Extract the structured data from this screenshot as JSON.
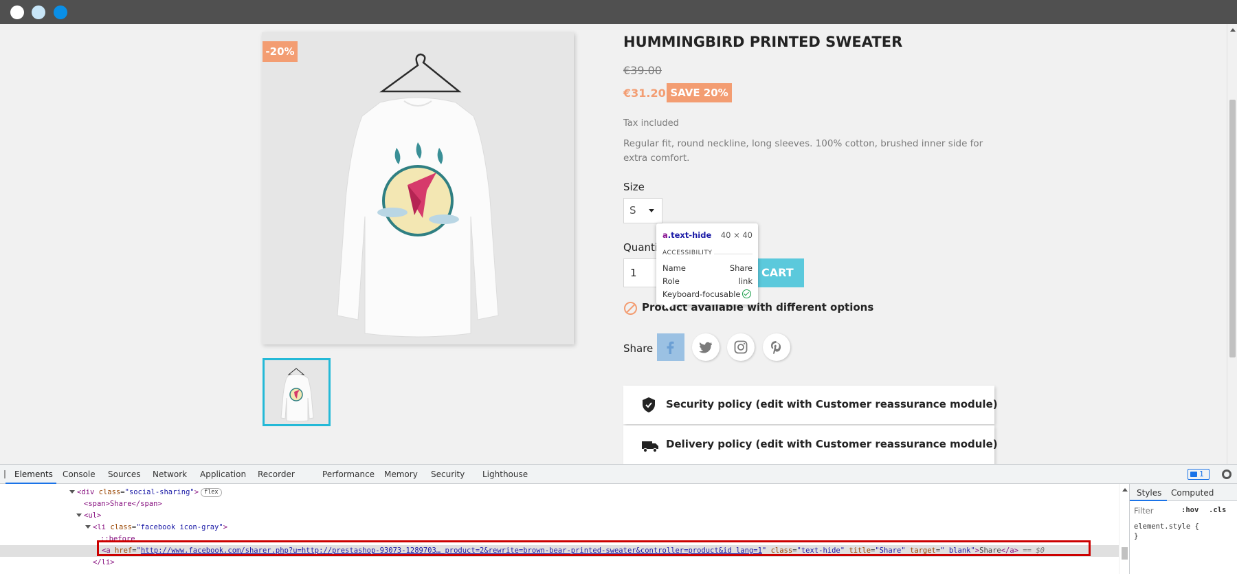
{
  "window": {
    "controls": [
      "close",
      "minimize",
      "maximize"
    ]
  },
  "product": {
    "discount_badge": "-20%",
    "title": "HUMMINGBIRD PRINTED SWEATER",
    "old_price": "€39.00",
    "new_price": "€31.20",
    "save_badge": "SAVE 20%",
    "tax_note": "Tax included",
    "description": "Regular fit, round neckline, long sleeves. 100% cotton, brushed inner side for extra comfort.",
    "size_label": "Size",
    "size_value": "S",
    "quantity_label": "Quantity",
    "quantity_value": "1",
    "add_to_cart_label": "CART",
    "availability_text": "Product available with different options",
    "share_label": "Share",
    "social_icons": [
      "facebook-icon",
      "twitter-icon",
      "instagram-icon",
      "pinterest-icon"
    ],
    "reassurance": [
      "Security policy (edit with Customer reassurance module)",
      "Delivery policy (edit with Customer reassurance module)"
    ]
  },
  "tooltip": {
    "selector_tag": "a",
    "selector_class": ".text-hide",
    "dimensions": "40 × 40",
    "section": "ACCESSIBILITY",
    "rows": [
      {
        "label": "Name",
        "value": "Share"
      },
      {
        "label": "Role",
        "value": "link"
      },
      {
        "label": "Keyboard-focusable",
        "value": ""
      }
    ]
  },
  "devtools": {
    "tabs": [
      "Elements",
      "Console",
      "Sources",
      "Network",
      "Application",
      "Recorder",
      "Performance",
      "Memory",
      "Security",
      "Lighthouse"
    ],
    "issues_count": "1",
    "dom": {
      "line1_tag": "div",
      "line1_attr": "class",
      "line1_val": "social-sharing",
      "line1_badge": "flex",
      "line2": "<span>Share</span>",
      "line3": "<ul>",
      "line4_tag": "li",
      "line4_attr": "class",
      "line4_val": "facebook icon-gray",
      "line5": "::before",
      "line6_href": "http://www.facebook.com/sharer.php?u=http://prestashop-93073-1289703… product=2&rewrite=brown-bear-printed-sweater&controller=product&id_lang=1",
      "line6_class": "text-hide",
      "line6_title": "Share",
      "line6_target": "_blank",
      "line6_text": "Share",
      "line6_suffix": "== $0",
      "line7": "</li>"
    },
    "styles": {
      "tabs": [
        "Styles",
        "Computed"
      ],
      "filter_placeholder": "Filter",
      "hov": ":hov",
      "cls": ".cls",
      "rule_open": "element.style {",
      "rule_close": "}"
    }
  },
  "colors": {
    "accent": "#f39d72",
    "cart_button": "#5bc9dc",
    "thumb_border": "#24b9d7",
    "devtools_highlight": "#1a73e8"
  }
}
